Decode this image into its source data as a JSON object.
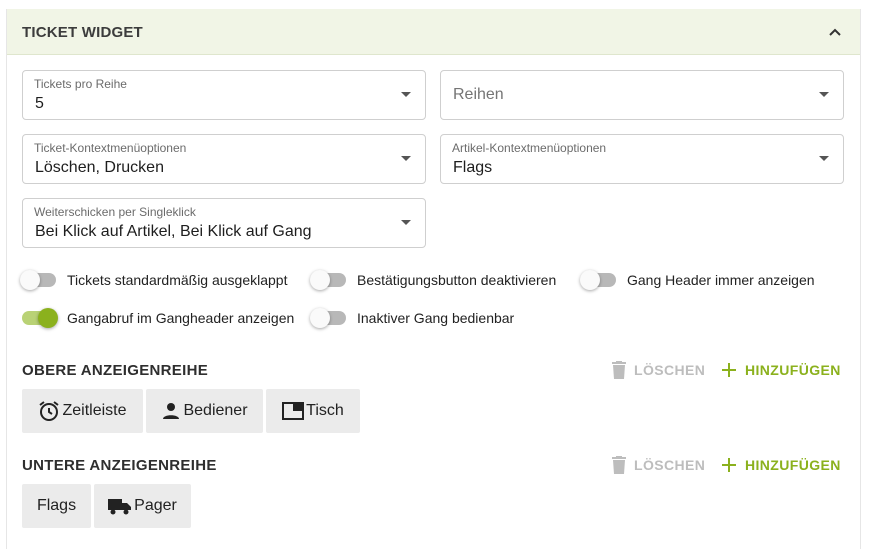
{
  "panel": {
    "title": "TICKET WIDGET"
  },
  "fields": {
    "tickets_pro_reihe": {
      "label": "Tickets pro Reihe",
      "value": "5"
    },
    "reihen": {
      "placeholder": "Reihen"
    },
    "ticket_menu": {
      "label": "Ticket-Kontextmenüoptionen",
      "value": "Löschen, Drucken"
    },
    "artikel_menu": {
      "label": "Artikel-Kontextmenüoptionen",
      "value": "Flags"
    },
    "singleklick": {
      "label": "Weiterschicken per Singleklick",
      "value": "Bei Klick auf Artikel, Bei Klick auf Gang"
    }
  },
  "toggles": [
    {
      "label": "Tickets standardmäßig ausgeklappt",
      "on": false
    },
    {
      "label": "Bestätigungsbutton deaktivieren",
      "on": false
    },
    {
      "label": "Gang Header immer anzeigen",
      "on": false
    },
    {
      "label": "Gangabruf im Gangheader anzeigen",
      "on": true
    },
    {
      "label": "Inaktiver Gang bedienbar",
      "on": false
    }
  ],
  "upper": {
    "title": "OBERE ANZEIGENREIHE",
    "delete_label": "LÖSCHEN",
    "add_label": "HINZUFÜGEN",
    "chips": [
      {
        "label": "Zeitleiste",
        "icon": "alarm-clock-icon"
      },
      {
        "label": "Bediener",
        "icon": "person-icon"
      },
      {
        "label": "Tisch",
        "icon": "table-window-icon"
      }
    ]
  },
  "lower": {
    "title": "UNTERE ANZEIGENREIHE",
    "delete_label": "LÖSCHEN",
    "add_label": "HINZUFÜGEN",
    "chips": [
      {
        "label": "Flags",
        "icon": ""
      },
      {
        "label": "Pager",
        "icon": "truck-icon"
      }
    ]
  },
  "colors": {
    "accent": "#8bb11d",
    "header_bg": "#f1f5e6",
    "chip_bg": "#ebebeb"
  }
}
